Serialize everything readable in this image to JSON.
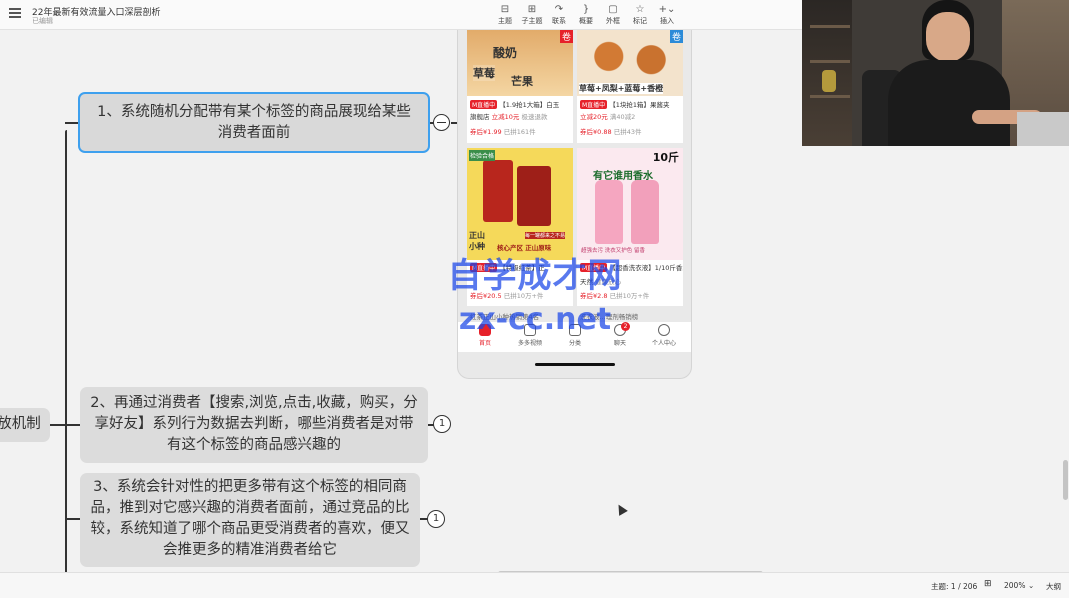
{
  "doc": {
    "title": "22年最新有效流量入口深层剖析",
    "status": "已编辑"
  },
  "toolbar": {
    "items": [
      {
        "label": "主题",
        "icon": "theme-icon"
      },
      {
        "label": "子主题",
        "icon": "subtopic-icon"
      },
      {
        "label": "联系",
        "icon": "relation-icon"
      },
      {
        "label": "概要",
        "icon": "summary-icon"
      },
      {
        "label": "外框",
        "icon": "boundary-icon"
      },
      {
        "label": "标记",
        "icon": "marker-icon"
      },
      {
        "label": "插入",
        "icon": "insert-icon"
      }
    ]
  },
  "mindmap": {
    "root_label": "放机制",
    "node1": "1、系统随机分配带有某个标签的商品展现给某些消费者面前",
    "node2": "2、再通过消费者【搜索,浏览,点击,收藏，购买，分享好友】系列行为数据去判断，哪些消费者是对带有这个标签的商品感兴趣的",
    "node2_badge": "1",
    "node3": "3、系统会针对性的把更多带有这个标签的相同商品，推到对它感兴趣的消费者面前，通过竞品的比较，系统知道了哪个商品更受消费者的喜欢，便又会推更多的精准消费者给它",
    "node3_badge": "1"
  },
  "phone": {
    "cards": [
      {
        "img_text_1": "酸奶",
        "img_text_2": "草莓",
        "img_text_3": "芒果",
        "img_corner": "卷",
        "tag": "M直播中",
        "title": "【1.9抢1大箱】白玉",
        "shop": "旗舰店",
        "promo": "立减10元",
        "extra": "极速退款",
        "price": "券后¥1.99",
        "sold": "已拼161件"
      },
      {
        "img_text_1": "草莓+凤梨+蓝莓+香橙",
        "img_corner": "卷",
        "tag": "M直播中",
        "title": "【1块抢1箱】果酱夹",
        "promo": "立减20元",
        "extra": "满40减2",
        "price": "券后¥0.88",
        "sold": "已拼43件"
      },
      {
        "img_text_1": "正山",
        "img_text_2": "小种",
        "img_text_3": "核心产区 正山原味",
        "img_text_4": "每一罐都来之不易",
        "img_badge": "检验合格",
        "tag": "M直播中",
        "title": "【特级红茶】正",
        "price": "券后¥20.5",
        "sold": "已拼10万+件"
      },
      {
        "img_text_1": "10斤",
        "img_text_2": "有它谁用香水",
        "img_text_3": "超强去污 洗衣又护色 留香",
        "tag": "M直播中",
        "title": "【超香洗衣液】1/10斤香水",
        "shop": "天然",
        "extra": "健康放心",
        "price": "券后¥2.8",
        "sold": "已拼10万+件"
      }
    ],
    "rank_left": "红茶正山小种热销第4名",
    "rank_right": "洗衣液...理剂畅销榜",
    "tabs": [
      {
        "label": "首页",
        "active": true
      },
      {
        "label": "多多视频"
      },
      {
        "label": "分类"
      },
      {
        "label": "聊天",
        "badge": "2"
      },
      {
        "label": "个人中心"
      }
    ]
  },
  "watermark": {
    "line1": "自学成才网",
    "line2": "zx-cc.net"
  },
  "statusbar": {
    "topic_count": "主题: 1 / 206",
    "zoom": "200%",
    "outline_label": "大纲"
  },
  "colors": {
    "accent_blue": "#3ea0ee",
    "brand_red": "#e6212a",
    "watermark": "#1a46e8"
  }
}
